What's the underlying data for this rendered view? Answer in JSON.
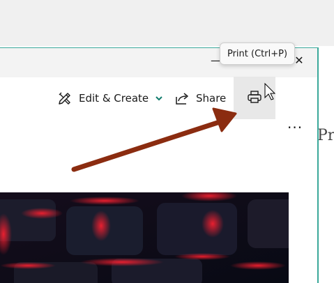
{
  "toolbar": {
    "edit_create_label": "Edit & Create",
    "share_label": "Share",
    "more_label": "···"
  },
  "window_controls": {
    "minimize": "—",
    "close": "✕"
  },
  "tooltip": {
    "text": "Print (Ctrl+P)"
  },
  "background_window": {
    "partial_text": "Pr"
  },
  "colors": {
    "window_border": "#3aa89a",
    "accent_chevron": "#0f7b6c",
    "arrow": "#8b2c10",
    "photo_glow": "#ff2030"
  },
  "icons": [
    "edit-create-icon",
    "chevron-down-icon",
    "share-icon",
    "printer-icon",
    "more-icon",
    "mouse-cursor-icon",
    "annotation-arrow"
  ]
}
